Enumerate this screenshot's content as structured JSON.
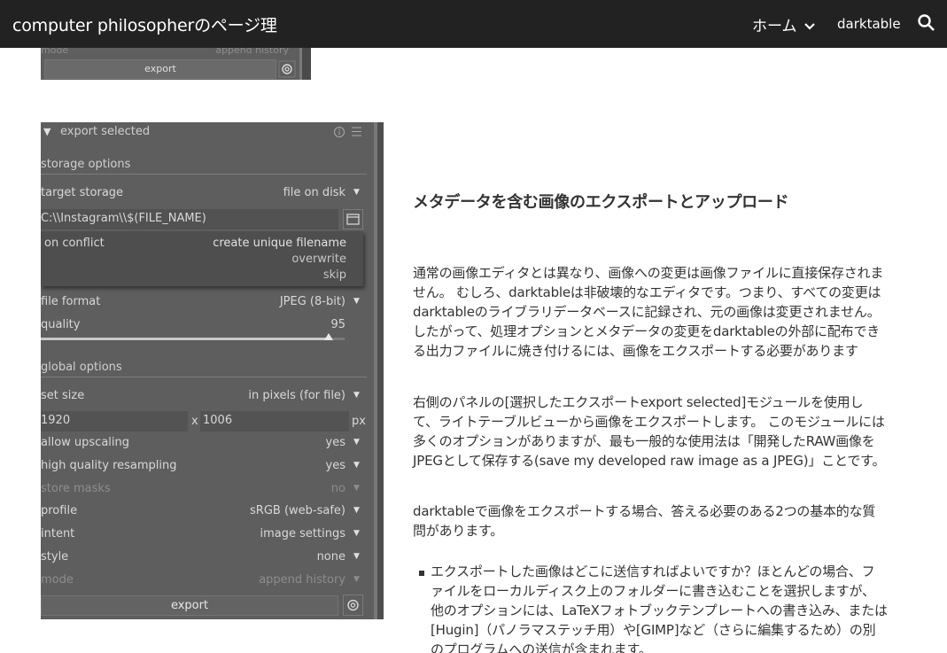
{
  "nav": {
    "site_title": "computer philosopherのページ理",
    "home_label": "ホーム",
    "darktable_label": "darktable",
    "icons": [
      "chevron-down-icon",
      "search-icon"
    ]
  },
  "top_screenshot": {
    "mode_label": "mode",
    "mode_value": "append history",
    "export_label": "export"
  },
  "export_panel": {
    "title": "export selected",
    "storage_section": "storage options",
    "target_storage_label": "target storage",
    "target_storage_value": "file on disk",
    "path_value": "C:\\\\Instagram\\\\$(FILE_NAME)",
    "on_conflict_label": "on conflict",
    "conflict_options": [
      "create unique filename",
      "overwrite",
      "skip"
    ],
    "file_format_label": "file format",
    "file_format_value": "JPEG (8-bit)",
    "quality_label": "quality",
    "quality_value": "95",
    "quality_level": 0.95,
    "global_section": "global options",
    "set_size_label": "set size",
    "set_size_value": "in pixels (for file)",
    "width_value": "1920",
    "x_label": "x",
    "height_value": "1006",
    "unit_label": "px",
    "allow_upscaling_label": "allow upscaling",
    "allow_upscaling_value": "yes",
    "hq_resampling_label": "high quality resampling",
    "hq_resampling_value": "yes",
    "store_masks_label": "store masks",
    "store_masks_value": "no",
    "profile_label": "profile",
    "profile_value": "sRGB (web-safe)",
    "intent_label": "intent",
    "intent_value": "image settings",
    "style_label": "style",
    "style_value": "none",
    "mode_label": "mode",
    "mode_value": "append history",
    "export_button": "export"
  },
  "article": {
    "heading": "メタデータを含む画像のエクスポートとアップロード",
    "para1": "通常の画像エディタとは異なり、画像への変更は画像ファイルに直接保存されません。 むしろ、darktableは非破壊的なエディタです。つまり、すべての変更はdarktableのライブラリデータベースに記録され、元の画像は変更されません。 したがって、処理オプションとメタデータの変更をdarktableの外部に配布できる出力ファイルに焼き付けるには、画像をエクスポートする必要があります",
    "para2": "右側のパネルの[選択したエクスポートexport selected]モジュールを使用して、ライトテーブルビューから画像をエクスポートします。 このモジュールには多くのオプションがありますが、最も一般的な使用法は「開発したRAW画像をJPEGとして保存する(save my developed raw image as a JPEG)」ことです。",
    "para3": "darktableで画像をエクスポートする場合、答える必要のある2つの基本的な質問があります。",
    "bullet1": "エクスポートした画像はどこに送信すればよいですか？ほとんどの場合、ファイルをローカルディスク上のフォルダーに書き込むことを選択しますが、他のオプションには、LaTeXフォトブックテンプレートへの書き込み、または[Hugin]（パノラマステッチ用）や[GIMP]など（さらに編集するため）の別のプログラムへの送信が含まれます。"
  }
}
